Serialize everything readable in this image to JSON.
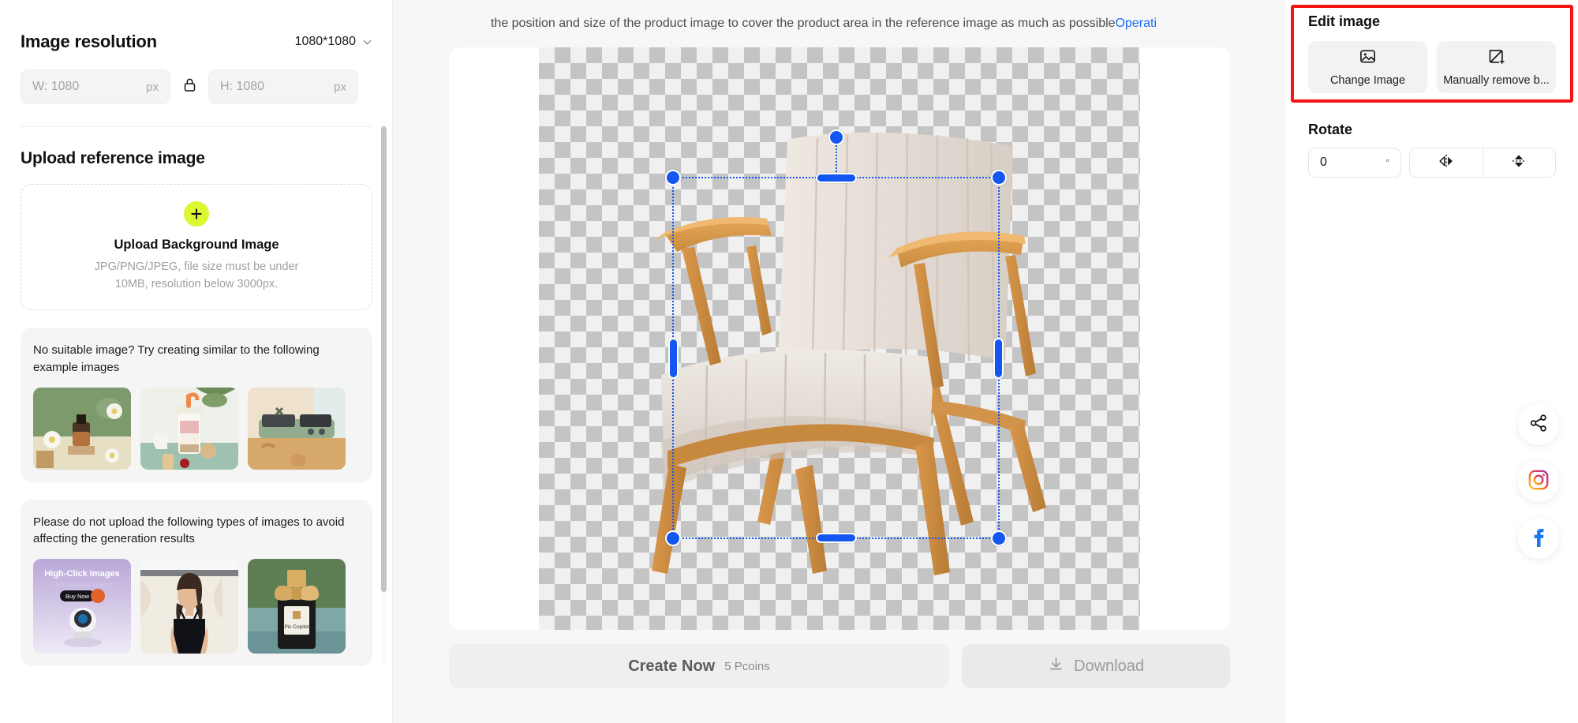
{
  "left_panel": {
    "resolution": {
      "title": "Image resolution",
      "selected": "1080*1080",
      "width_placeholder": "W: 1080",
      "height_placeholder": "H: 1080",
      "unit": "px",
      "lock_icon": "lock-icon",
      "chevron_icon": "chevron-down-icon"
    },
    "upload": {
      "section_title": "Upload reference image",
      "plus_icon": "plus-icon",
      "title": "Upload Background Image",
      "description": "JPG/PNG/JPEG, file size must be under 10MB, resolution below 3000px."
    },
    "examples": {
      "text": "No suitable image? Try creating similar to the following example images",
      "thumbnails": [
        {
          "name": "perfume-bottle-green-backdrop"
        },
        {
          "name": "layered-yogurt-smoothie-cup"
        },
        {
          "name": "green-electric-grill"
        }
      ]
    },
    "avoid": {
      "text": "Please do not upload the following types of images to avoid affecting the generation results",
      "thumbnails": [
        {
          "name": "security-camera-ad",
          "headline": "High-Click Images",
          "subline": "Click-boosting images",
          "cta": "Buy Now"
        },
        {
          "name": "model-in-black-dress"
        },
        {
          "name": "perfume-with-gold-bow",
          "label": "Pic Copilot"
        }
      ]
    }
  },
  "center": {
    "notice": {
      "text": "the position and size of the product image to cover the product area in the reference image as much as possible",
      "link": "Operati"
    },
    "canvas": {
      "checkerboard": "transparent-background",
      "image_name": "wooden-armchair-product-photo",
      "selection": {
        "handles": [
          "rotate",
          "top-left",
          "top-center",
          "top-right",
          "middle-left",
          "middle-right",
          "bottom-left",
          "bottom-center",
          "bottom-right"
        ],
        "color": "#1456f0"
      }
    },
    "actions": {
      "create_label": "Create Now",
      "create_cost": "5 Pcoins",
      "download_label": "Download",
      "download_icon": "download-icon"
    }
  },
  "right_panel": {
    "edit": {
      "title": "Edit image",
      "buttons": [
        {
          "label": "Change Image",
          "icon": "image-icon"
        },
        {
          "label": "Manually remove b...",
          "icon": "magic-eraser-icon"
        }
      ],
      "highlight_color": "#f51313"
    },
    "rotate": {
      "title": "Rotate",
      "value": "0",
      "degree_symbol": "°",
      "flip_horizontal_icon": "flip-horizontal-icon",
      "flip_vertical_icon": "flip-vertical-icon"
    },
    "social": [
      {
        "name": "share-icon"
      },
      {
        "name": "instagram-icon"
      },
      {
        "name": "facebook-icon"
      }
    ]
  },
  "colors": {
    "accent_yellow": "#dcf731",
    "selection_blue": "#1456f0",
    "link_blue": "#1a6cf5",
    "annotation_red": "#f51313"
  }
}
